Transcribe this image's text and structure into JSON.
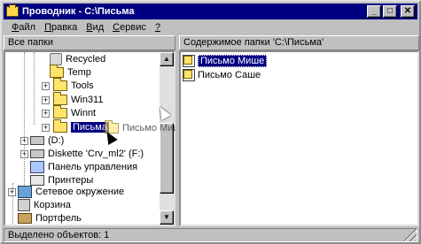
{
  "window": {
    "title": "Проводник - C:\\Письма",
    "minimize": "_",
    "maximize": "□",
    "close": "✕"
  },
  "menu": [
    {
      "label": "Файл",
      "u": "Ф",
      "rest": "айл"
    },
    {
      "label": "Правка",
      "u": "П",
      "rest": "равка"
    },
    {
      "label": "Вид",
      "u": "В",
      "rest": "ид"
    },
    {
      "label": "Сервис",
      "u": "С",
      "rest": "ервис"
    },
    {
      "label": "?",
      "u": "?",
      "rest": ""
    }
  ],
  "left_header": "Все папки",
  "right_header": "Содержимое папки 'C:\\Письма'",
  "tree": [
    {
      "label": "Recycled",
      "icon": "recycle-icon"
    },
    {
      "label": "Temp",
      "icon": "folder-icon"
    },
    {
      "label": "Tools",
      "icon": "folder-icon"
    },
    {
      "label": "Win311",
      "icon": "folder-icon"
    },
    {
      "label": "Winnt",
      "icon": "folder-icon"
    },
    {
      "label": "Письма",
      "icon": "folder-open-icon"
    },
    {
      "label": "(D:)",
      "icon": "drive-icon"
    },
    {
      "label": "Diskette 'Crv_ml2' (F:)",
      "icon": "drive-icon"
    },
    {
      "label": "Панель управления",
      "icon": "control-panel-icon"
    },
    {
      "label": "Принтеры",
      "icon": "printer-icon"
    },
    {
      "label": "Сетевое окружение",
      "icon": "network-icon"
    },
    {
      "label": "Корзина",
      "icon": "recycle-bin-icon"
    },
    {
      "label": "Портфель",
      "icon": "briefcase-icon"
    }
  ],
  "drag_label": "Письмо Мише",
  "files": [
    {
      "label": "Письмо Мише",
      "icon": "document-icon"
    },
    {
      "label": "Письмо Саше",
      "icon": "document-icon"
    }
  ],
  "status": "Выделено объектов: 1",
  "colors": {
    "titlebar": "#000080",
    "selection": "#000080",
    "face": "#c0c0c0"
  }
}
